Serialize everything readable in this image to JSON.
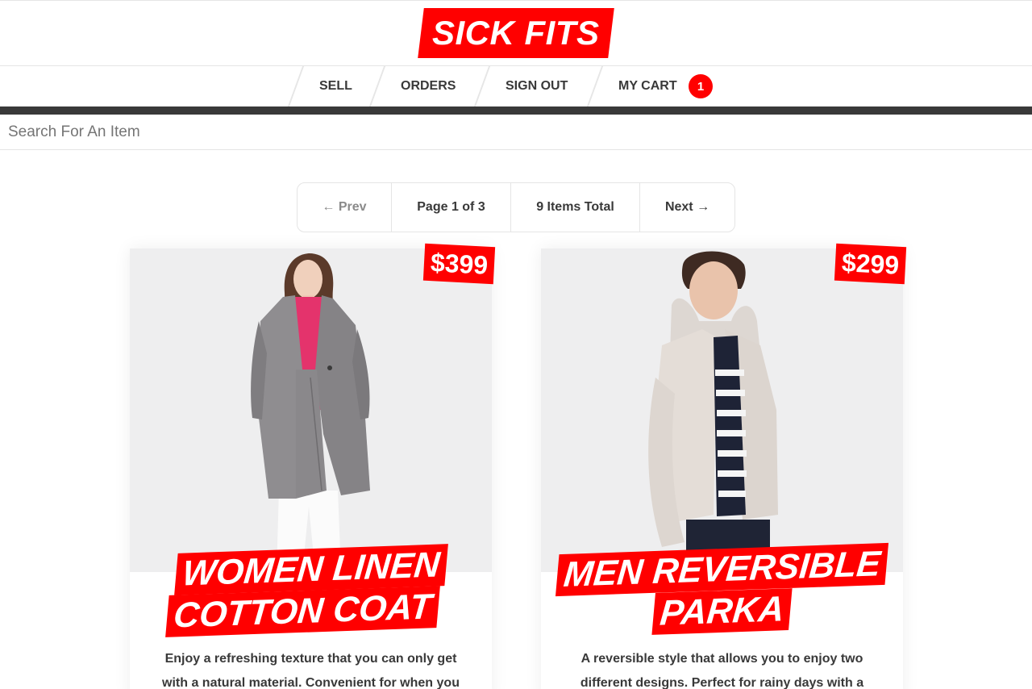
{
  "brand": {
    "logo": "SICK FITS",
    "accent": "#ff0000",
    "dark": "#393939"
  },
  "nav": {
    "items": [
      {
        "label": "SELL"
      },
      {
        "label": "ORDERS"
      },
      {
        "label": "SIGN OUT"
      },
      {
        "label": "MY CART"
      }
    ],
    "cart_count": "1"
  },
  "search": {
    "placeholder": "Search For An Item",
    "value": ""
  },
  "pagination": {
    "prev_label": "← Prev",
    "page_label": "Page 1 of 3",
    "total_label": "9 Items Total",
    "next_label": "Next →"
  },
  "products": [
    {
      "price": "$399",
      "title_line1": "WOMEN LINEN",
      "title_line2": "COTTON COAT",
      "description": "Enjoy a refreshing texture that you can only get with a natural material. Convenient for when you",
      "image_icon": "coat-photo"
    },
    {
      "price": "$299",
      "title_line1": "MEN REVERSIBLE",
      "title_line2": "PARKA",
      "description": "A reversible style that allows you to enjoy two different designs. Perfect for rainy days with a",
      "image_icon": "parka-photo"
    }
  ]
}
